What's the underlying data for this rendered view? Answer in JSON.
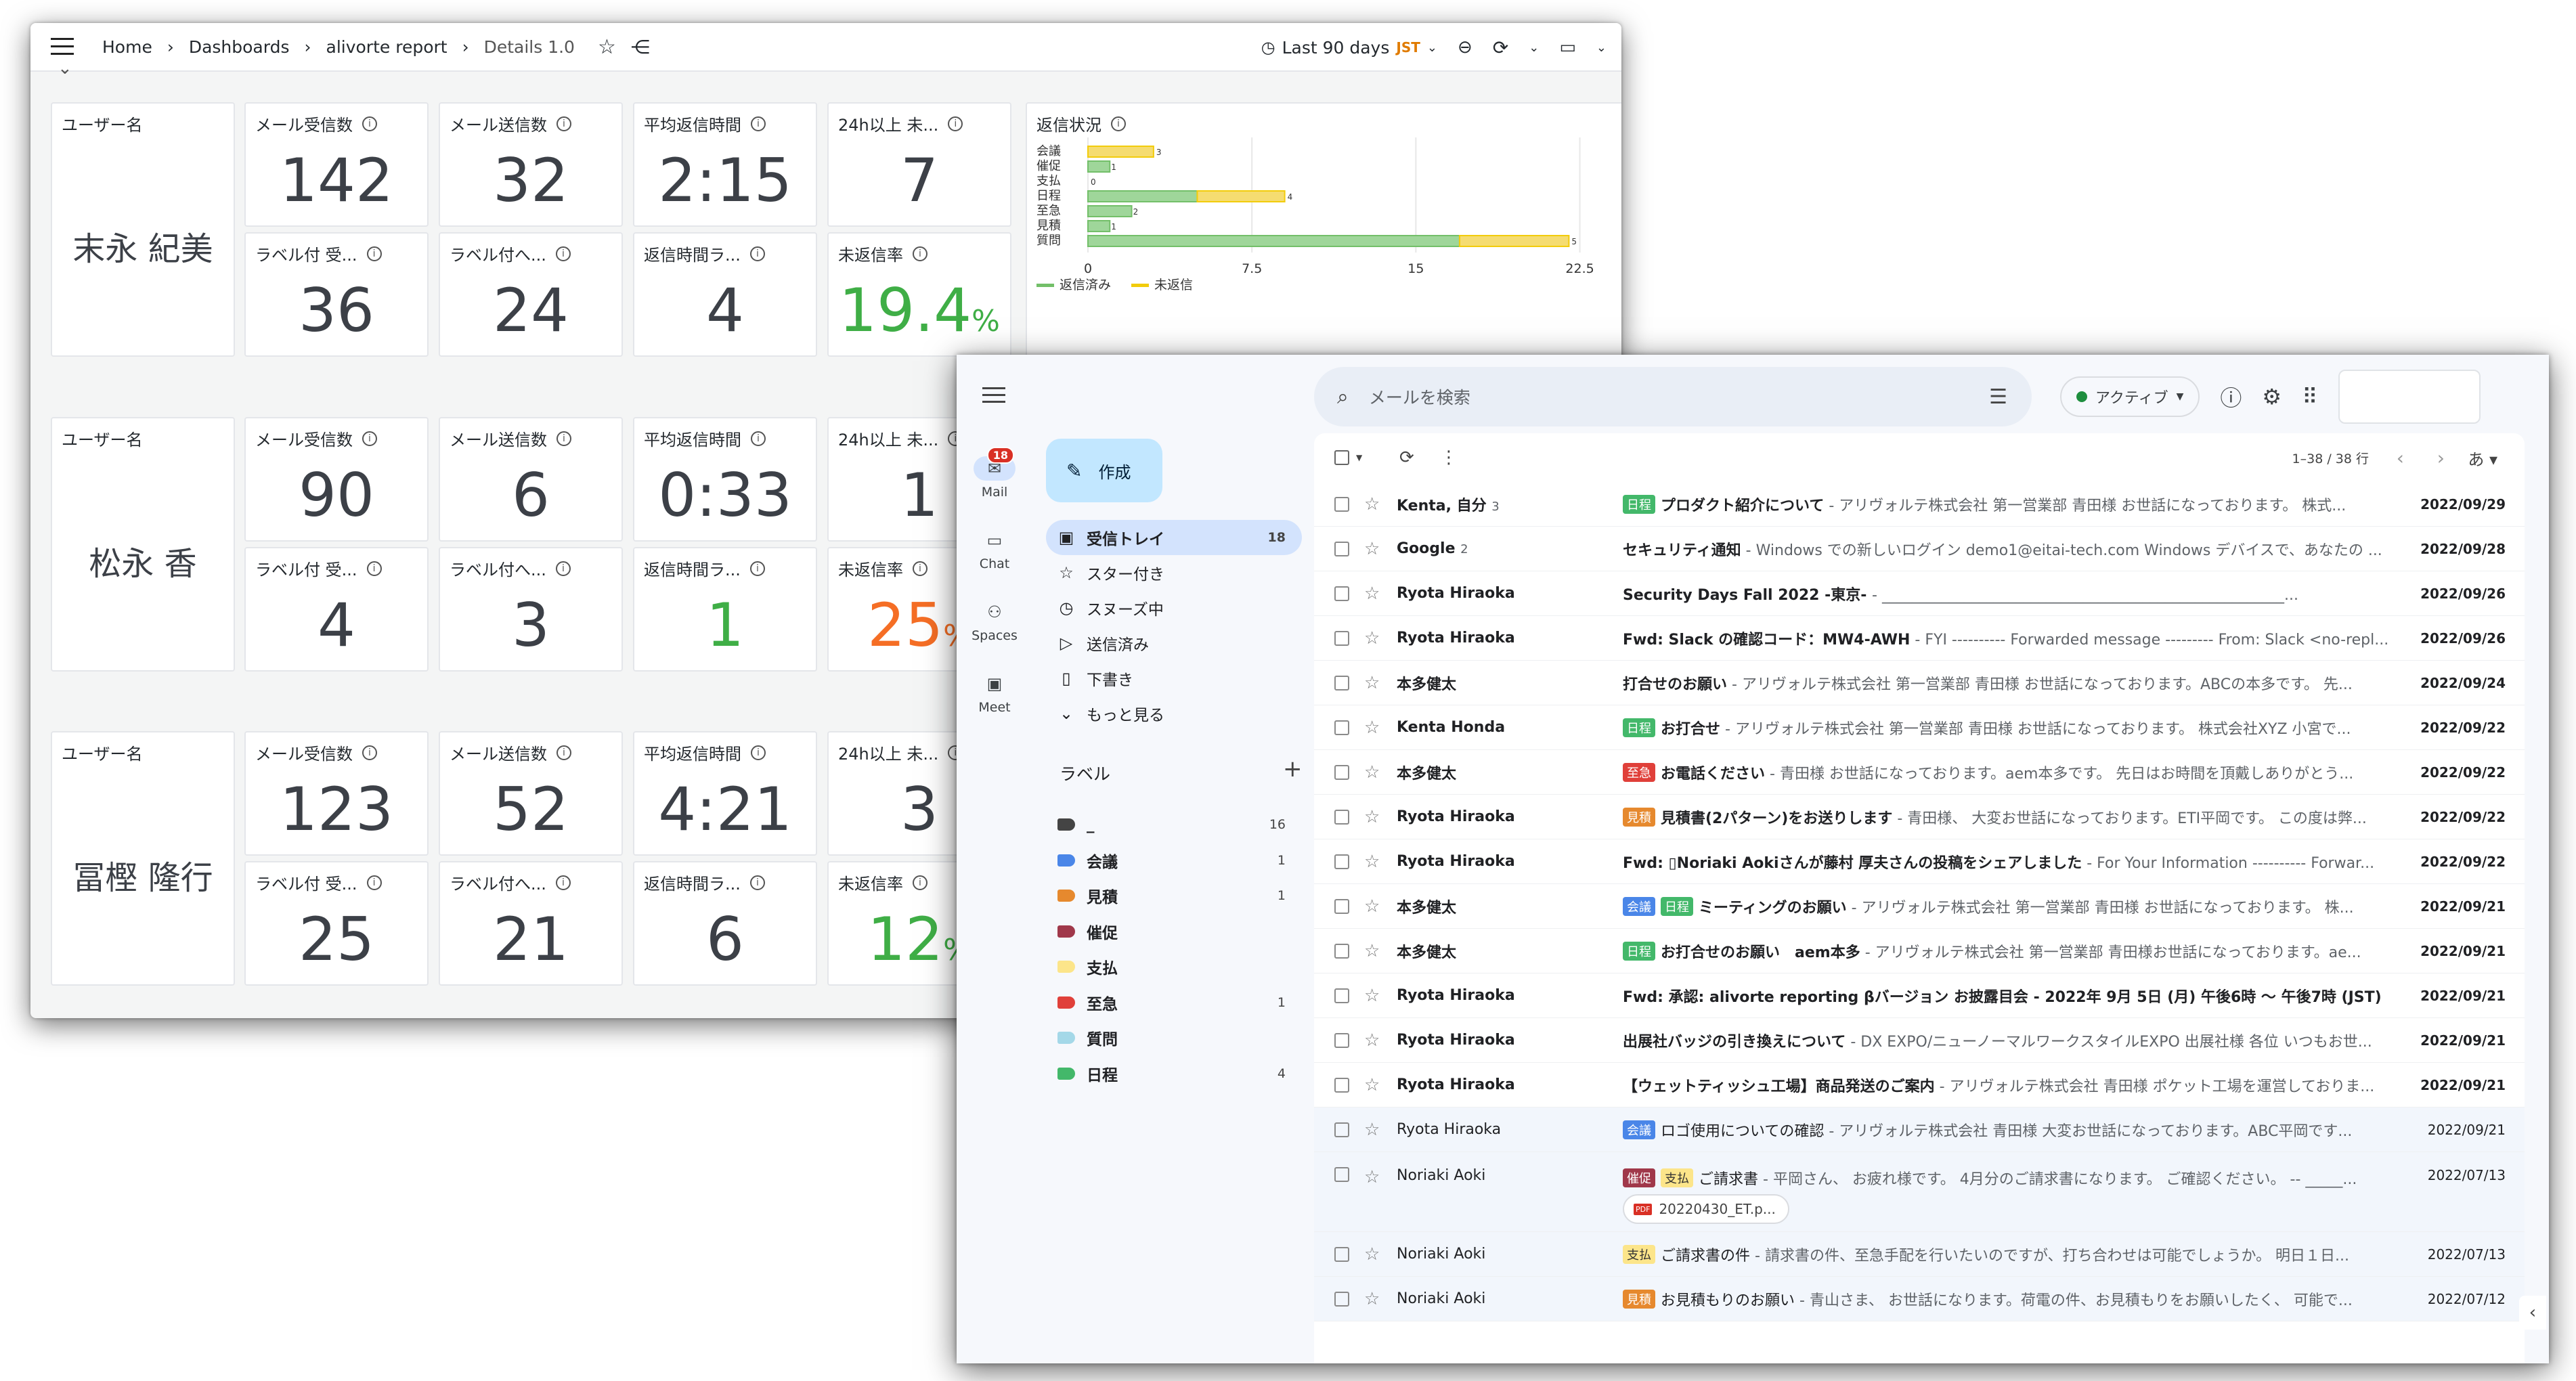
{
  "dashboard": {
    "breadcrumb": [
      "Home",
      "Dashboards",
      "alivorte report",
      "Details 1.0"
    ],
    "time_range": "Last 90 days",
    "timezone": "JST",
    "rows": [
      {
        "user_label": "ユーザー名",
        "user_name": "末永 紀美",
        "received_label": "メール受信数",
        "received": "142",
        "sent_label": "メール送信数",
        "sent": "32",
        "avg_reply_label": "平均返信時間",
        "avg_reply": "2:15",
        "over24_label": "24h以上 未...",
        "over24": "7",
        "labeled_recv_label": "ラベル付 受...",
        "labeled_recv": "36",
        "labeled_sent_label": "ラベル付へ...",
        "labeled_sent": "24",
        "reply_rank_label": "返信時間ラ...",
        "reply_rank": "4",
        "unreplied_label": "未返信率",
        "unreplied": "19.4",
        "unreplied_unit": "%"
      },
      {
        "user_label": "ユーザー名",
        "user_name": "松永 香",
        "received_label": "メール受信数",
        "received": "90",
        "sent_label": "メール送信数",
        "sent": "6",
        "avg_reply_label": "平均返信時間",
        "avg_reply": "0:33",
        "over24_label": "24h以上 未...",
        "over24": "1",
        "labeled_recv_label": "ラベル付 受...",
        "labeled_recv": "4",
        "labeled_sent_label": "ラベル付へ...",
        "labeled_sent": "3",
        "reply_rank_label": "返信時間ラ...",
        "reply_rank": "1",
        "unreplied_label": "未返信率",
        "unreplied": "25",
        "unreplied_unit": "%"
      },
      {
        "user_label": "ユーザー名",
        "user_name": "冨樫 隆行",
        "received_label": "メール受信数",
        "received": "123",
        "sent_label": "メール送信数",
        "sent": "52",
        "avg_reply_label": "平均返信時間",
        "avg_reply": "4:21",
        "over24_label": "24h以上 未...",
        "over24": "3",
        "labeled_recv_label": "ラベル付 受...",
        "labeled_recv": "25",
        "labeled_sent_label": "ラベル付へ...",
        "labeled_sent": "21",
        "reply_rank_label": "返信時間ラ...",
        "reply_rank": "6",
        "unreplied_label": "未返信率",
        "unreplied": "12",
        "unreplied_unit": "%"
      }
    ]
  },
  "chart_data": {
    "type": "bar",
    "orientation": "horizontal",
    "stacked": true,
    "title": "返信状況",
    "categories": [
      "会議",
      "催促",
      "支払",
      "日程",
      "至急",
      "見積",
      "質問"
    ],
    "series": [
      {
        "name": "返信済み",
        "color": "#73bf69",
        "values": [
          0,
          1,
          0,
          5,
          2,
          1,
          17
        ]
      },
      {
        "name": "未返信",
        "color": "#f2cc0c",
        "values": [
          3,
          0,
          0,
          4,
          0,
          0,
          5
        ]
      }
    ],
    "xticks": [
      "0",
      "7.5",
      "15",
      "22.5"
    ],
    "xlim": [
      0,
      24
    ],
    "legend": "bottom-left"
  },
  "gmail": {
    "search_placeholder": "メールを検索",
    "status": "アクティブ",
    "compose": "作成",
    "rail": [
      {
        "label": "Mail",
        "badge": "18"
      },
      {
        "label": "Chat"
      },
      {
        "label": "Spaces"
      },
      {
        "label": "Meet"
      }
    ],
    "nav": [
      {
        "label": "受信トレイ",
        "count": "18"
      },
      {
        "label": "スター付き"
      },
      {
        "label": "スヌーズ中"
      },
      {
        "label": "送信済み"
      },
      {
        "label": "下書き"
      },
      {
        "label": "もっと見る"
      }
    ],
    "labels_header": "ラベル",
    "labels": [
      {
        "name": "_",
        "color": "#444444",
        "count": "16"
      },
      {
        "name": "会議",
        "color": "#4a86e8",
        "count": "1"
      },
      {
        "name": "見積",
        "color": "#e6892e",
        "count": "1"
      },
      {
        "name": "催促",
        "color": "#a0384a",
        "count": ""
      },
      {
        "name": "支払",
        "color": "#fce58a",
        "count": ""
      },
      {
        "name": "至急",
        "color": "#e0403a",
        "count": "1"
      },
      {
        "name": "質問",
        "color": "#a4d8e8",
        "count": ""
      },
      {
        "name": "日程",
        "color": "#43b86a",
        "count": "4"
      }
    ],
    "pagination": "1–38 / 38 行",
    "input_tool": "あ",
    "emails": [
      {
        "sender": "Kenta, 自分",
        "sender_count": "3",
        "tags": [
          {
            "t": "日程",
            "c": "#43b86a"
          }
        ],
        "subject": "プロダクト紹介について",
        "snippet": " - アリヴォルテ株式会社 第一営業部 青田様 お世話になっております。 株式...",
        "date": "2022/09/29",
        "read": false
      },
      {
        "sender": "Google",
        "sender_count": "2",
        "tags": [],
        "subject": "セキュリティ通知",
        "snippet": " - Windows での新しいログイン demo1@eitai-tech.com Windows デバイスで、あなたの ...",
        "date": "2022/09/28",
        "read": false
      },
      {
        "sender": "Ryota Hiraoka",
        "sender_count": "",
        "tags": [],
        "subject": "Security Days Fall 2022 -東京- ",
        "snippet": "- ______________________________________________________...",
        "date": "2022/09/26",
        "read": false
      },
      {
        "sender": "Ryota Hiraoka",
        "sender_count": "",
        "tags": [],
        "subject": "Fwd: Slack の確認コード：MW4-AWH",
        "snippet": " - FYI ---------- Forwarded message --------- From: Slack <no-repl...",
        "date": "2022/09/26",
        "read": false
      },
      {
        "sender": "本多健太",
        "sender_count": "",
        "tags": [],
        "subject": "打合せのお願い",
        "snippet": " - アリヴォルテ株式会社 第一営業部 青田様 お世話になっております。ABCの本多です。 先...",
        "date": "2022/09/24",
        "read": false
      },
      {
        "sender": "Kenta Honda",
        "sender_count": "",
        "tags": [
          {
            "t": "日程",
            "c": "#43b86a"
          }
        ],
        "subject": "お打合せ",
        "snippet": " - アリヴォルテ株式会社 第一営業部 青田様 お世話になっております。 株式会社XYZ 小宮で...",
        "date": "2022/09/22",
        "read": false
      },
      {
        "sender": "本多健太",
        "sender_count": "",
        "tags": [
          {
            "t": "至急",
            "c": "#e0403a"
          }
        ],
        "subject": "お電話ください",
        "snippet": " - 青田様 お世話になっております。aem本多です。 先日はお時間を頂戴しありがとう...",
        "date": "2022/09/22",
        "read": false
      },
      {
        "sender": "Ryota Hiraoka",
        "sender_count": "",
        "tags": [
          {
            "t": "見積",
            "c": "#e6892e"
          }
        ],
        "subject": "見積書(2パターン)をお送りします",
        "snippet": " - 青田様、 大変お世話になっております。ETI平岡です。 この度は弊...",
        "date": "2022/09/22",
        "read": false
      },
      {
        "sender": "Ryota Hiraoka",
        "sender_count": "",
        "tags": [],
        "subject": "Fwd: ▯Noriaki Aokiさんが藤村 厚夫さんの投稿をシェアしました",
        "snippet": " - For Your Information ---------- Forwar...",
        "date": "2022/09/22",
        "read": false
      },
      {
        "sender": "本多健太",
        "sender_count": "",
        "tags": [
          {
            "t": "会議",
            "c": "#4a86e8"
          },
          {
            "t": "日程",
            "c": "#43b86a"
          }
        ],
        "subject": "ミーティングのお願い",
        "snippet": " - アリヴォルテ株式会社 第一営業部 青田様 お世話になっております。 株...",
        "date": "2022/09/21",
        "read": false
      },
      {
        "sender": "本多健太",
        "sender_count": "",
        "tags": [
          {
            "t": "日程",
            "c": "#43b86a"
          }
        ],
        "subject": "お打合せのお願い　aem本多",
        "snippet": " - アリヴォルテ株式会社 第一営業部 青田様お世話になっております。ae...",
        "date": "2022/09/21",
        "read": false
      },
      {
        "sender": "Ryota Hiraoka",
        "sender_count": "",
        "tags": [],
        "subject": "Fwd: 承認: alivorte reporting βバージョン お披露目会 - 2022年 9月 5日 (月) 午後6時 〜 午後7時 (JST) (rh...",
        "snippet": "",
        "date": "2022/09/21",
        "read": false
      },
      {
        "sender": "Ryota Hiraoka",
        "sender_count": "",
        "tags": [],
        "subject": "出展社バッジの引き換えについて",
        "snippet": " - DX EXPO/ニューノーマルワークスタイルEXPO 出展社様 各位 いつもお世...",
        "date": "2022/09/21",
        "read": false
      },
      {
        "sender": "Ryota Hiraoka",
        "sender_count": "",
        "tags": [],
        "subject": "【ウェットティッシュ工場】商品発送のご案内",
        "snippet": " - アリヴォルテ株式会社 青田様 ポケット工場を運営しておりま...",
        "date": "2022/09/21",
        "read": false
      },
      {
        "sender": "Ryota Hiraoka",
        "sender_count": "",
        "tags": [
          {
            "t": "会議",
            "c": "#4a86e8"
          }
        ],
        "subject": "ロゴ使用についての確認",
        "snippet": " - アリヴォルテ株式会社 青田様 大変お世話になっております。ABC平岡です...",
        "date": "2022/09/21",
        "read": true
      },
      {
        "sender": "Noriaki Aoki",
        "sender_count": "",
        "tags": [
          {
            "t": "催促",
            "c": "#a0384a"
          },
          {
            "t": "支払",
            "c": "#fce58a"
          }
        ],
        "subject": "ご請求書",
        "snippet": " - 平岡さん、 お疲れ様です。 4月分のご請求書になります。 ご確認ください。 -- _____...",
        "date": "2022/07/13",
        "read": true,
        "attachment": "20220430_ET.p..."
      },
      {
        "sender": "Noriaki Aoki",
        "sender_count": "",
        "tags": [
          {
            "t": "支払",
            "c": "#fce58a"
          }
        ],
        "subject": "ご請求書の件",
        "snippet": " - 請求書の件、至急手配を行いたいのですが、打ち合わせは可能でしょうか。 明日１日...",
        "date": "2022/07/13",
        "read": true
      },
      {
        "sender": "Noriaki Aoki",
        "sender_count": "",
        "tags": [
          {
            "t": "見積",
            "c": "#e6892e"
          }
        ],
        "subject": "お見積もりのお願い",
        "snippet": " - 青山さま、 お世話になります。荷電の件、お見積もりをお願いしたく、 可能で...",
        "date": "2022/07/12",
        "read": true
      }
    ]
  }
}
